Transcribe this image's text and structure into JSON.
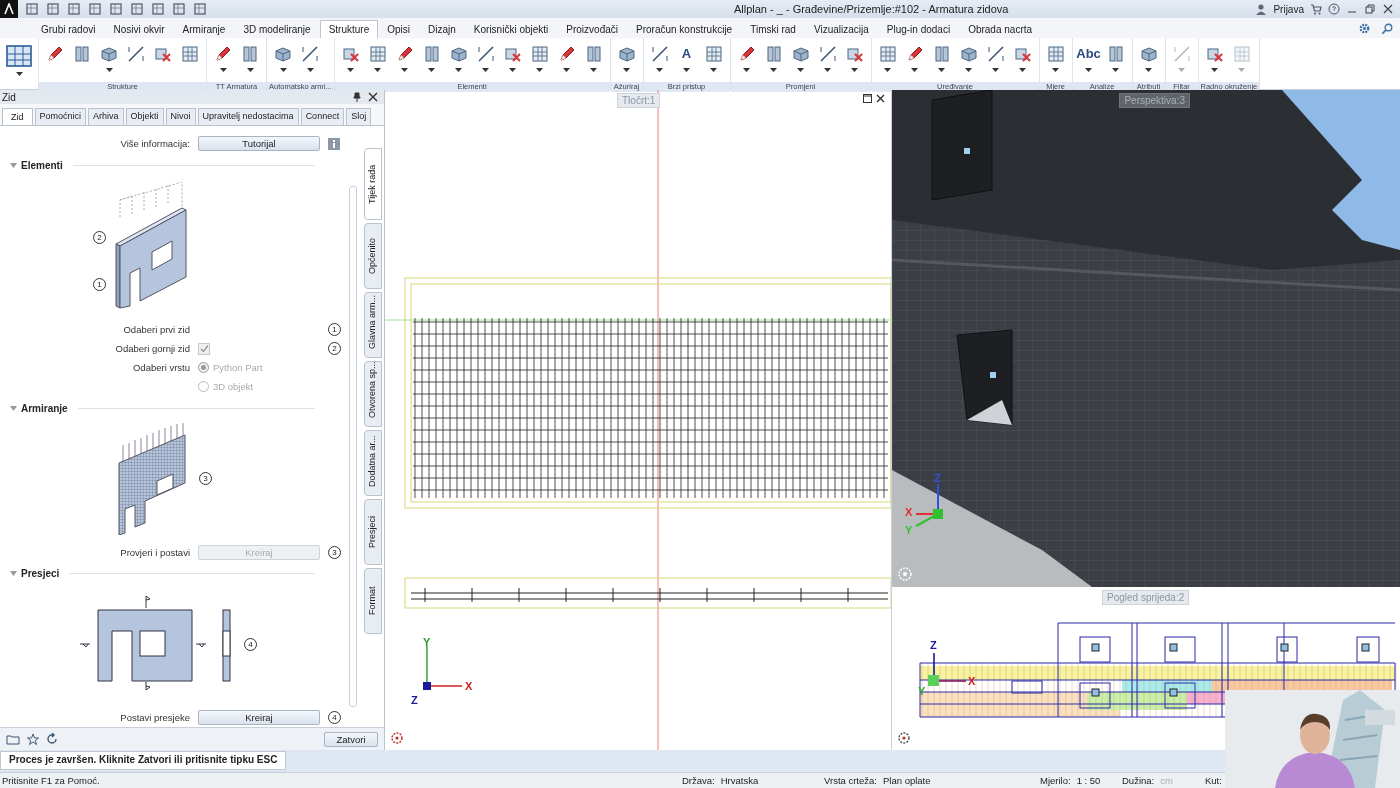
{
  "title_bar": {
    "title": "Allplan - _ - Građevine/Prizemlje:#102 - Armatura zidova",
    "user": "Prijava"
  },
  "ribbon_tabs": [
    {
      "label": "Grubi radovi",
      "selected": false
    },
    {
      "label": "Nosivi okvir",
      "selected": false
    },
    {
      "label": "Armiranje",
      "selected": false
    },
    {
      "label": "3D modeliranje",
      "selected": false
    },
    {
      "label": "Strukture",
      "selected": true
    },
    {
      "label": "Opisi",
      "selected": false
    },
    {
      "label": "Dizajn",
      "selected": false
    },
    {
      "label": "Korisnički objekti",
      "selected": false
    },
    {
      "label": "Proizvođači",
      "selected": false
    },
    {
      "label": "Proračun konstrukcije",
      "selected": false
    },
    {
      "label": "Timski rad",
      "selected": false
    },
    {
      "label": "Vizualizacija",
      "selected": false
    },
    {
      "label": "Plug-in dodaci",
      "selected": false
    },
    {
      "label": "Obrada nacrta",
      "selected": false
    }
  ],
  "ribbon_groups": [
    {
      "tools": [
        {
          "dropdown": true,
          "disabled": false
        }
      ]
    },
    {
      "label": "Strukture",
      "tools": [
        {
          "dropdown": false,
          "disabled": false
        },
        {
          "dropdown": false,
          "disabled": false
        },
        {
          "dropdown": true,
          "disabled": false
        },
        {
          "dropdown": false,
          "disabled": false
        },
        {
          "dropdown": false,
          "disabled": false
        },
        {
          "dropdown": false,
          "disabled": false
        }
      ]
    },
    {
      "label": "TT Armatura",
      "tools": [
        {
          "dropdown": true,
          "disabled": false
        },
        {
          "dropdown": true,
          "disabled": false
        }
      ]
    },
    {
      "label": "Automatsko armi...",
      "tools": [
        {
          "dropdown": true,
          "disabled": false
        },
        {
          "dropdown": true,
          "disabled": false
        }
      ]
    },
    {
      "label": "Elementi",
      "tools": [
        {
          "dropdown": true,
          "disabled": false
        },
        {
          "dropdown": true,
          "disabled": false
        },
        {
          "dropdown": true,
          "disabled": false
        },
        {
          "dropdown": true,
          "disabled": false
        },
        {
          "dropdown": true,
          "disabled": false
        },
        {
          "dropdown": true,
          "disabled": false
        },
        {
          "dropdown": true,
          "disabled": false
        },
        {
          "dropdown": true,
          "disabled": false
        },
        {
          "dropdown": true,
          "disabled": false
        },
        {
          "dropdown": true,
          "disabled": false
        }
      ]
    },
    {
      "label": "Ažuriraj",
      "tools": [
        {
          "dropdown": true,
          "disabled": false
        }
      ]
    },
    {
      "label": "Brzi pristup",
      "tools": [
        {
          "dropdown": true,
          "disabled": false
        },
        {
          "dropdown": true,
          "disabled": false,
          "glyph": "A"
        },
        {
          "dropdown": true,
          "disabled": false
        }
      ]
    },
    {
      "label": "Promjeni",
      "tools": [
        {
          "dropdown": true,
          "disabled": false
        },
        {
          "dropdown": true,
          "disabled": false
        },
        {
          "dropdown": true,
          "disabled": false
        },
        {
          "dropdown": true,
          "disabled": false
        },
        {
          "dropdown": true,
          "disabled": false
        }
      ]
    },
    {
      "label": "Uređivanje",
      "tools": [
        {
          "dropdown": true,
          "disabled": false
        },
        {
          "dropdown": true,
          "disabled": false
        },
        {
          "dropdown": true,
          "disabled": false
        },
        {
          "dropdown": true,
          "disabled": false
        },
        {
          "dropdown": true,
          "disabled": false
        },
        {
          "dropdown": true,
          "disabled": false
        }
      ]
    },
    {
      "label": "Mjere",
      "tools": [
        {
          "dropdown": true,
          "disabled": false
        }
      ]
    },
    {
      "label": "Analize",
      "tools": [
        {
          "dropdown": true,
          "disabled": false,
          "glyph": "Abc"
        },
        {
          "dropdown": true,
          "disabled": false
        }
      ]
    },
    {
      "label": "Atributi",
      "tools": [
        {
          "dropdown": true,
          "disabled": false
        }
      ]
    },
    {
      "label": "Filtar",
      "tools": [
        {
          "dropdown": true,
          "disabled": true
        }
      ]
    },
    {
      "label": "Radno okruženje",
      "tools": [
        {
          "dropdown": true,
          "disabled": false
        },
        {
          "dropdown": true,
          "disabled": true
        }
      ]
    }
  ],
  "panel": {
    "title": "Zid",
    "tabs": [
      {
        "label": "Zid",
        "selected": true
      },
      {
        "label": "Pomoćnici",
        "selected": false
      },
      {
        "label": "Arhiva",
        "selected": false
      },
      {
        "label": "Objekti",
        "selected": false
      },
      {
        "label": "Nivoi",
        "selected": false
      },
      {
        "label": "Upravitelj nedostacima",
        "selected": false
      },
      {
        "label": "Connect",
        "selected": false
      },
      {
        "label": "Sloj",
        "selected": false
      }
    ],
    "side_tabs": [
      {
        "label": "Tijek rada",
        "selected": true
      },
      {
        "label": "Općenito",
        "selected": false
      },
      {
        "label": "Glavna arm...",
        "selected": false
      },
      {
        "label": "Otvorena sp...",
        "selected": false
      },
      {
        "label": "Dodatna ar...",
        "selected": false
      },
      {
        "label": "Presjeci",
        "selected": false
      },
      {
        "label": "Format",
        "selected": false
      }
    ],
    "info_label": "Više informacija:",
    "info_button": "Tutorijal",
    "sections": [
      {
        "title": "Elementi",
        "expanded": true,
        "kind": "wall",
        "figure_marks": [
          "2",
          "1"
        ],
        "rows": [
          {
            "kind": "step",
            "label": "Odaberi prvi zid",
            "step": "1"
          },
          {
            "kind": "checkbox",
            "label": "Odaberi gornji zid",
            "checked": true,
            "disabled": true,
            "step": "2"
          },
          {
            "kind": "radio",
            "label": "Odaberi vrstu",
            "disabled": true,
            "options": [
              {
                "label": "Python Part",
                "selected": true
              },
              {
                "label": "3D objekt",
                "selected": false
              }
            ]
          }
        ]
      },
      {
        "title": "Armiranje",
        "expanded": true,
        "kind": "mesh",
        "figure_marks": [
          "3"
        ],
        "rows": [
          {
            "kind": "button",
            "label": "Provjeri i postavi",
            "button": "Kreiraj",
            "disabled": true,
            "step": "3"
          }
        ]
      },
      {
        "title": "Presjeci",
        "expanded": true,
        "kind": "section",
        "figure_marks": [
          "4"
        ],
        "rows": [
          {
            "kind": "button",
            "label": "Postavi presjeke",
            "button": "Kreiraj",
            "disabled": false,
            "step": "4"
          }
        ]
      }
    ],
    "close_button": "Zatvori"
  },
  "plan_view": {
    "title": "Tločrt:1",
    "axes": [
      "Y",
      "X",
      "Z"
    ]
  },
  "perspective_view": {
    "title": "Perspektiva:3",
    "axes": [
      "Z",
      "X",
      "Y"
    ]
  },
  "front_view": {
    "title": "Pogled sprijeda:2",
    "axes": [
      "Z",
      "X",
      "Y"
    ]
  },
  "prompt": "Proces je završen. Kliknite Zatvori ili pritisnite tipku ESC",
  "status_bar": {
    "help": "Pritisnite F1 za Pomoć.",
    "fields": [
      {
        "label": "Država:",
        "value": "Hrvatska",
        "dimmed": false
      },
      {
        "label": "Vrsta crteža:",
        "value": "Plan oplate",
        "dimmed": false
      },
      {
        "label": "Mjerilo:",
        "value": "1 : 50",
        "dimmed": false
      },
      {
        "label": "Dužina:",
        "value": "cm",
        "dimmed": true
      },
      {
        "label": "Kut:"
      }
    ]
  }
}
